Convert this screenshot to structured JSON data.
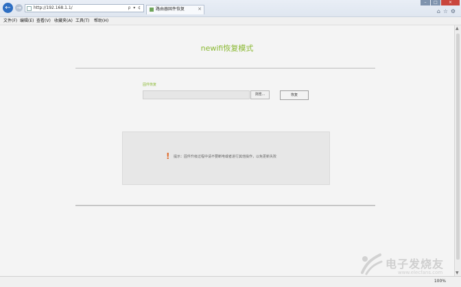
{
  "browser": {
    "address_url": "http://192.168.1.1/",
    "address_controls": "ρ ▾ ¢",
    "tab_title": "路由器固件恢复",
    "tab_close": "×",
    "zoom": "100%"
  },
  "menubar": {
    "items": [
      "文件(F)",
      "编辑(E)",
      "查看(V)",
      "收藏夹(A)",
      "工具(T)",
      "帮助(H)"
    ]
  },
  "page": {
    "title": "newifi恢复模式",
    "field_label": "固件恢复",
    "browse_label": "浏览...",
    "restore_label": "恢复",
    "notice_icon": "!",
    "notice_text": "提示：固件升级过程中请不要断电或者进行其他操作，以免更新失败"
  },
  "watermark": {
    "name": "电子发烧友",
    "url": "www.elecfans.com"
  },
  "colors": {
    "accent": "#8ab832",
    "warning": "#e06a2a"
  }
}
